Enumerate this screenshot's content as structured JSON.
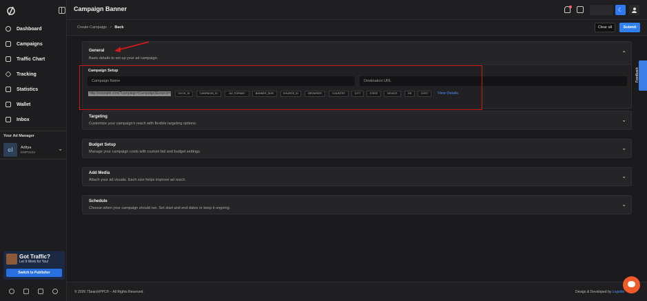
{
  "topbar": {
    "title": "Campaign Banner"
  },
  "sidebar": {
    "items": [
      {
        "label": "Dashboard"
      },
      {
        "label": "Campaigns"
      },
      {
        "label": "Traffic Chart"
      },
      {
        "label": "Tracking"
      },
      {
        "label": "Statistics"
      },
      {
        "label": "Wallet"
      },
      {
        "label": "Inbox"
      }
    ],
    "manager": {
      "title": "Your Ad Manager",
      "name": "Aditya",
      "id": "EMP3104",
      "avatar": "el"
    },
    "promo": {
      "title": "Got Traffic?",
      "subtitle": "Let It Work for You!",
      "button": "Switch to Publisher"
    }
  },
  "breadcrumb": {
    "parent": "Create Campaign",
    "separator": ">",
    "current": "Back"
  },
  "actions": {
    "clear": "Clear all",
    "submit": "Submit"
  },
  "sections": {
    "general": {
      "title": "General",
      "desc": "Basic details to set up your ad campaign."
    },
    "campaign_setup": {
      "title": "Campaign Setup",
      "name_placeholder": "Campaign Name",
      "url_placeholder": "Destination URL",
      "url_template": "http://example.com/?campaign={campaign}&source={source}",
      "tags": [
        "CLICK_ID",
        "CAMPAIGN_ID",
        "AD_FORMAT",
        "BANNER_SIZE",
        "SOURCE_ID",
        "BROWSER",
        "COUNTRY",
        "CITY",
        "STATE",
        "DEVICE",
        "OS",
        "COST"
      ],
      "view_details": "View Details"
    },
    "targeting": {
      "title": "Targeting",
      "desc": "Customize your campaign's reach with flexible targeting options."
    },
    "budget": {
      "title": "Budget Setup",
      "desc": "Manage your campaign costs with custom bid and budget settings."
    },
    "media": {
      "title": "Add Media",
      "desc": "Attach your ad visuals. Each size helps improve ad reach."
    },
    "schedule": {
      "title": "Schedule",
      "desc": "Choose when your campaign should run. Set start and end dates or keep it ongoing."
    }
  },
  "feedback": "Feedback",
  "footer": {
    "copyright": "© 2026 7SearchPPC® – All Rights Reserved.",
    "credit": "Design & Developed by ",
    "credit_brand": "Logelite"
  },
  "colors": {
    "accent": "#3180f0",
    "highlight": "#d11a1a",
    "chat": "#f05a28"
  }
}
